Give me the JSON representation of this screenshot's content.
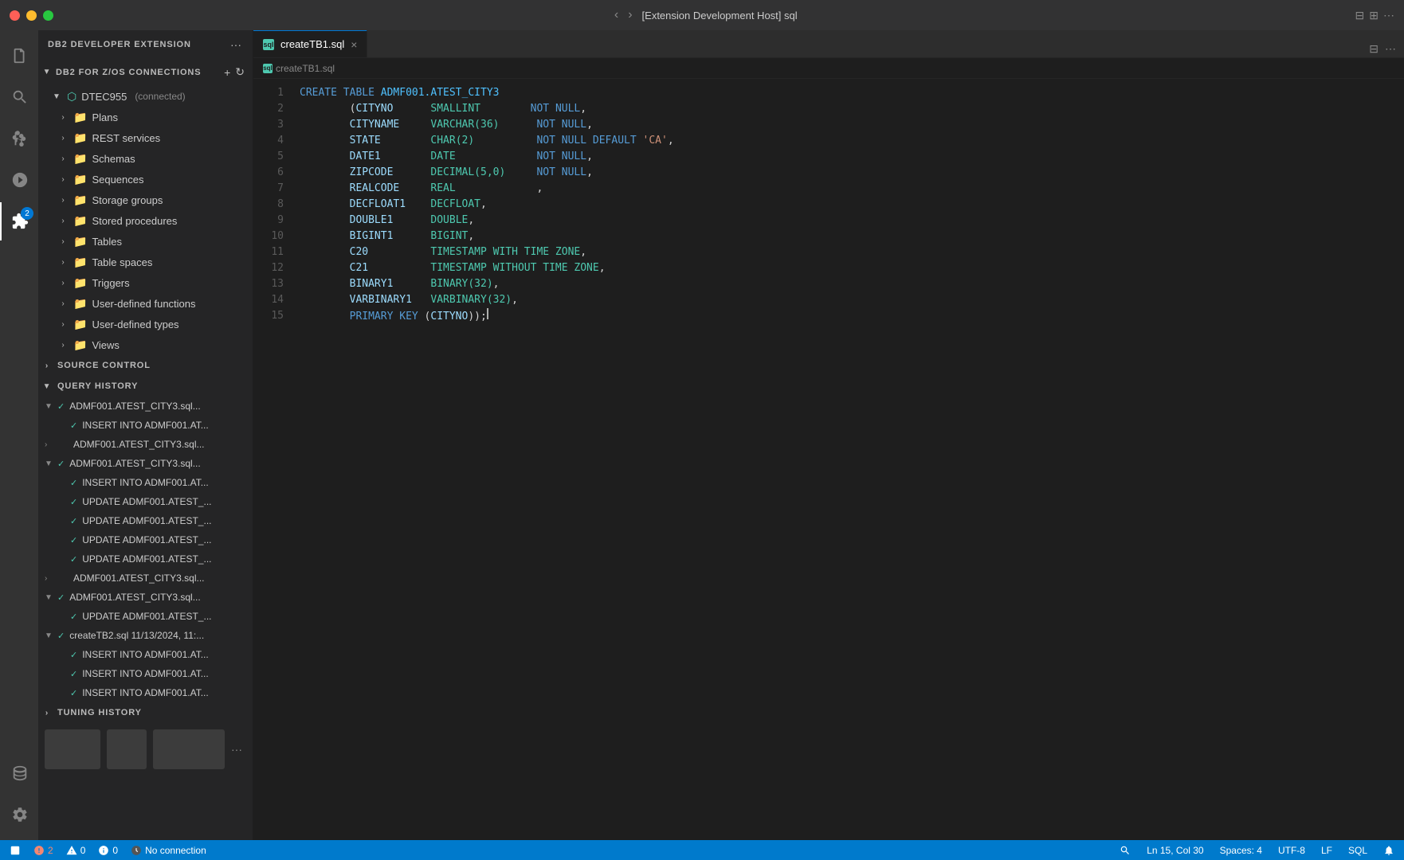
{
  "titlebar": {
    "title": "[Extension Development Host] sql",
    "nav_back": "‹",
    "nav_forward": "›"
  },
  "tab": {
    "filename": "createTB1.sql",
    "close": "×",
    "sql_label": "sql"
  },
  "breadcrumb": {
    "filename": "createTB1.sql"
  },
  "sidebar": {
    "extension_title": "DB2 DEVELOPER EXTENSION",
    "connections_section": "DB2 FOR Z/OS CONNECTIONS",
    "node": {
      "name": "DTEC955",
      "status": "connected",
      "children": [
        "Plans",
        "REST services",
        "Schemas",
        "Sequences",
        "Storage groups",
        "Stored procedures",
        "Tables",
        "Table spaces",
        "Triggers",
        "User-defined functions",
        "User-defined types",
        "Views"
      ]
    },
    "source_control": "SOURCE CONTROL",
    "query_history": "QUERY HISTORY",
    "tuning_history": "TUNING HISTORY",
    "query_items": [
      {
        "level": 0,
        "label": "ADMF001.ATEST_CITY3.sql...",
        "has_check": true,
        "expanded": true
      },
      {
        "level": 1,
        "label": "INSERT INTO ADMF001.AT...",
        "has_check": true
      },
      {
        "level": 0,
        "label": "ADMF001.ATEST_CITY3.sql...",
        "has_check": false,
        "expanded": false
      },
      {
        "level": 0,
        "label": "ADMF001.ATEST_CITY3.sql...",
        "has_check": true,
        "expanded": true
      },
      {
        "level": 1,
        "label": "INSERT INTO ADMF001.AT...",
        "has_check": true
      },
      {
        "level": 1,
        "label": "UPDATE ADMF001.ATEST_...",
        "has_check": true
      },
      {
        "level": 1,
        "label": "UPDATE ADMF001.ATEST_...",
        "has_check": true
      },
      {
        "level": 1,
        "label": "UPDATE ADMF001.ATEST_...",
        "has_check": true
      },
      {
        "level": 1,
        "label": "UPDATE ADMF001.ATEST_...",
        "has_check": true
      },
      {
        "level": 0,
        "label": "ADMF001.ATEST_CITY3.sql...",
        "has_check": false,
        "expanded": false
      },
      {
        "level": 0,
        "label": "ADMF001.ATEST_CITY3.sql...",
        "has_check": true,
        "expanded": true
      },
      {
        "level": 1,
        "label": "UPDATE ADMF001.ATEST_...",
        "has_check": true
      },
      {
        "level": 0,
        "label": "createTB2.sql  11/13/2024, 11:...",
        "has_check": true,
        "expanded": true
      },
      {
        "level": 1,
        "label": "INSERT INTO ADMF001.AT...",
        "has_check": true
      },
      {
        "level": 1,
        "label": "INSERT INTO ADMF001.AT...",
        "has_check": true
      },
      {
        "level": 1,
        "label": "INSERT INTO ADMF001.AT...",
        "has_check": true
      }
    ]
  },
  "editor": {
    "lines": [
      {
        "num": 1,
        "content": "CREATE TABLE ADMF001.ATEST_CITY3",
        "tokens": [
          {
            "t": "kw",
            "v": "CREATE"
          },
          {
            "t": "",
            "v": " "
          },
          {
            "t": "kw",
            "v": "TABLE"
          },
          {
            "t": "",
            "v": " "
          },
          {
            "t": "table-name",
            "v": "ADMF001.ATEST_CITY3"
          }
        ]
      },
      {
        "num": 2,
        "content": "        (CITYNO      SMALLINT        NOT NULL,",
        "tokens": [
          {
            "t": "",
            "v": "        ("
          },
          {
            "t": "col-name",
            "v": "CITYNO"
          },
          {
            "t": "",
            "v": "      "
          },
          {
            "t": "type",
            "v": "SMALLINT"
          },
          {
            "t": "",
            "v": "        "
          },
          {
            "t": "kw",
            "v": "NOT NULL"
          },
          {
            "t": "",
            "v": ","
          }
        ]
      },
      {
        "num": 3,
        "content": "        CITYNAME     VARCHAR(36)      NOT NULL,",
        "tokens": [
          {
            "t": "",
            "v": "        "
          },
          {
            "t": "col-name",
            "v": "CITYNAME"
          },
          {
            "t": "",
            "v": "     "
          },
          {
            "t": "type",
            "v": "VARCHAR(36)"
          },
          {
            "t": "",
            "v": "      "
          },
          {
            "t": "kw",
            "v": "NOT NULL"
          },
          {
            "t": "",
            "v": ","
          }
        ]
      },
      {
        "num": 4,
        "content": "        STATE        CHAR(2)          NOT NULL DEFAULT 'CA',",
        "tokens": [
          {
            "t": "",
            "v": "        "
          },
          {
            "t": "col-name",
            "v": "STATE"
          },
          {
            "t": "",
            "v": "        "
          },
          {
            "t": "type",
            "v": "CHAR(2)"
          },
          {
            "t": "",
            "v": "          "
          },
          {
            "t": "kw",
            "v": "NOT NULL DEFAULT"
          },
          {
            "t": "",
            "v": " "
          },
          {
            "t": "str",
            "v": "'CA'"
          },
          {
            "t": "",
            "v": ","
          }
        ]
      },
      {
        "num": 5,
        "content": "        DATE1        DATE             NOT NULL,",
        "tokens": [
          {
            "t": "",
            "v": "        "
          },
          {
            "t": "col-name",
            "v": "DATE1"
          },
          {
            "t": "",
            "v": "        "
          },
          {
            "t": "type",
            "v": "DATE"
          },
          {
            "t": "",
            "v": "             "
          },
          {
            "t": "kw",
            "v": "NOT NULL"
          },
          {
            "t": "",
            "v": ","
          }
        ]
      },
      {
        "num": 6,
        "content": "        ZIPCODE      DECIMAL(5,0)     NOT NULL,",
        "tokens": [
          {
            "t": "",
            "v": "        "
          },
          {
            "t": "col-name",
            "v": "ZIPCODE"
          },
          {
            "t": "",
            "v": "      "
          },
          {
            "t": "type",
            "v": "DECIMAL(5,0)"
          },
          {
            "t": "",
            "v": "     "
          },
          {
            "t": "kw",
            "v": "NOT NULL"
          },
          {
            "t": "",
            "v": ","
          }
        ]
      },
      {
        "num": 7,
        "content": "        REALCODE     REAL             ,",
        "tokens": [
          {
            "t": "",
            "v": "        "
          },
          {
            "t": "col-name",
            "v": "REALCODE"
          },
          {
            "t": "",
            "v": "     "
          },
          {
            "t": "type",
            "v": "REAL"
          },
          {
            "t": "",
            "v": "             ,"
          }
        ]
      },
      {
        "num": 8,
        "content": "        DECFLOAT1    DECFLOAT,",
        "tokens": [
          {
            "t": "",
            "v": "        "
          },
          {
            "t": "col-name",
            "v": "DECFLOAT1"
          },
          {
            "t": "",
            "v": "    "
          },
          {
            "t": "type",
            "v": "DECFLOAT"
          },
          {
            "t": "",
            "v": ","
          }
        ]
      },
      {
        "num": 9,
        "content": "        DOUBLE1      DOUBLE,",
        "tokens": [
          {
            "t": "",
            "v": "        "
          },
          {
            "t": "col-name",
            "v": "DOUBLE1"
          },
          {
            "t": "",
            "v": "      "
          },
          {
            "t": "type",
            "v": "DOUBLE"
          },
          {
            "t": "",
            "v": ","
          }
        ]
      },
      {
        "num": 10,
        "content": "        BIGINT1      BIGINT,",
        "tokens": [
          {
            "t": "",
            "v": "        "
          },
          {
            "t": "col-name",
            "v": "BIGINT1"
          },
          {
            "t": "",
            "v": "      "
          },
          {
            "t": "type",
            "v": "BIGINT"
          },
          {
            "t": "",
            "v": ","
          }
        ]
      },
      {
        "num": 11,
        "content": "        C20          TIMESTAMP WITH TIME ZONE,",
        "tokens": [
          {
            "t": "",
            "v": "        "
          },
          {
            "t": "col-name",
            "v": "C20"
          },
          {
            "t": "",
            "v": "          "
          },
          {
            "t": "type",
            "v": "TIMESTAMP WITH TIME ZONE"
          },
          {
            "t": "",
            "v": ","
          }
        ]
      },
      {
        "num": 12,
        "content": "        C21          TIMESTAMP WITHOUT TIME ZONE,",
        "tokens": [
          {
            "t": "",
            "v": "        "
          },
          {
            "t": "col-name",
            "v": "C21"
          },
          {
            "t": "",
            "v": "          "
          },
          {
            "t": "type",
            "v": "TIMESTAMP WITHOUT TIME ZONE"
          },
          {
            "t": "",
            "v": ","
          }
        ]
      },
      {
        "num": 13,
        "content": "        BINARY1      BINARY(32),",
        "tokens": [
          {
            "t": "",
            "v": "        "
          },
          {
            "t": "col-name",
            "v": "BINARY1"
          },
          {
            "t": "",
            "v": "      "
          },
          {
            "t": "type",
            "v": "BINARY(32)"
          },
          {
            "t": "",
            "v": ","
          }
        ]
      },
      {
        "num": 14,
        "content": "        VARBINARY1   VARBINARY(32),",
        "tokens": [
          {
            "t": "",
            "v": "        "
          },
          {
            "t": "col-name",
            "v": "VARBINARY1"
          },
          {
            "t": "",
            "v": "   "
          },
          {
            "t": "type",
            "v": "VARBINARY(32)"
          },
          {
            "t": "",
            "v": ","
          }
        ]
      },
      {
        "num": 15,
        "content": "        PRIMARY KEY (CITYNO));",
        "tokens": [
          {
            "t": "",
            "v": "        "
          },
          {
            "t": "kw",
            "v": "PRIMARY KEY"
          },
          {
            "t": "",
            "v": " ("
          },
          {
            "t": "col-name",
            "v": "CITYNO"
          },
          {
            "t": "",
            "v": "));"
          }
        ]
      }
    ]
  },
  "statusbar": {
    "errors": "2",
    "warnings": "0",
    "info": "0",
    "no_connection": "No connection",
    "position": "Ln 15, Col 30",
    "spaces": "Spaces: 4",
    "encoding": "UTF-8",
    "line_ending": "LF",
    "language": "SQL"
  },
  "activity_icons": {
    "explorer": "⊞",
    "search": "🔍",
    "git": "⑂",
    "debug": "▷",
    "extensions": "⊡",
    "settings": "⚙",
    "db2": "🗄"
  }
}
